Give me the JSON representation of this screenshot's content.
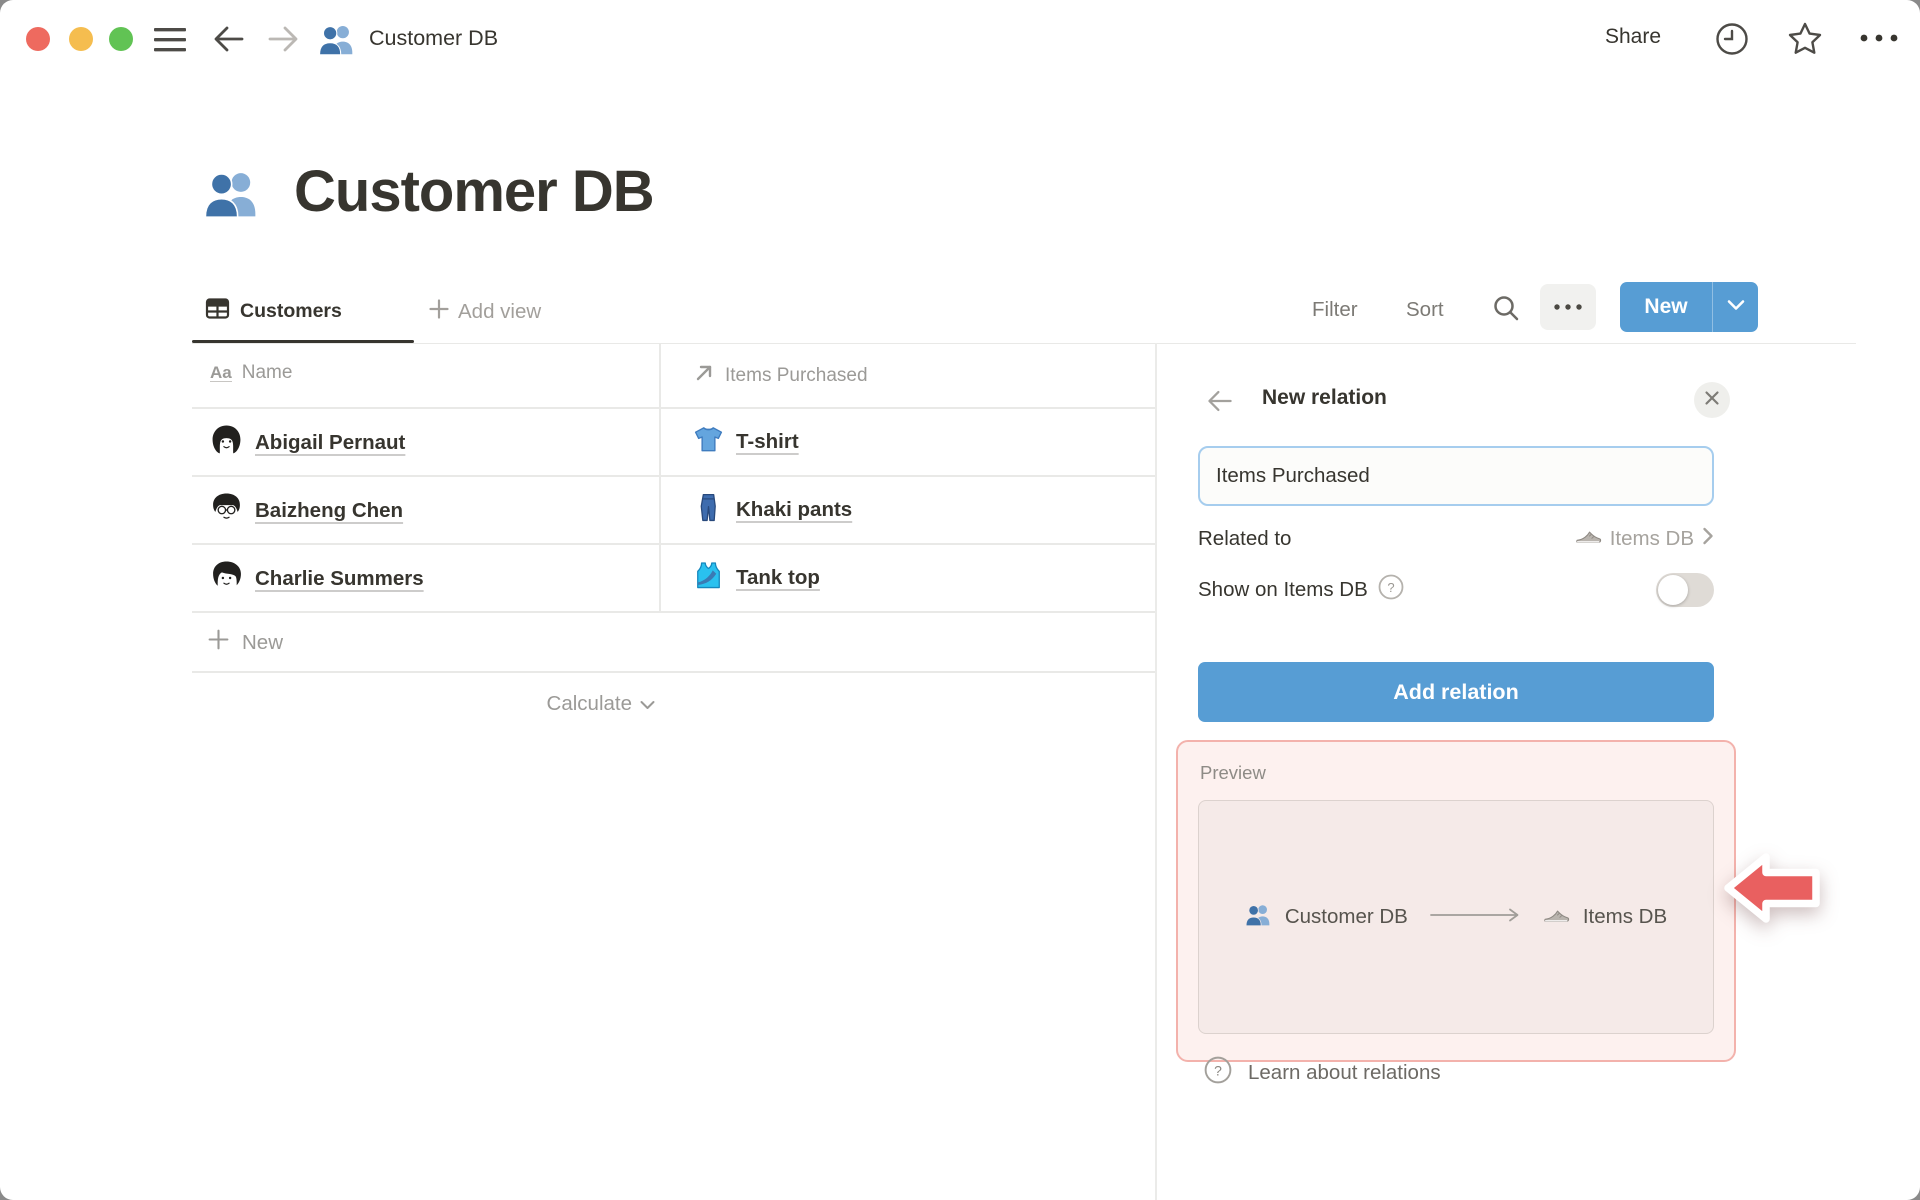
{
  "window": {
    "title": "Customer DB",
    "title_icon": "people-icon",
    "traffic_lights": [
      "close",
      "minimize",
      "zoom"
    ]
  },
  "titlebar": {
    "share_label": "Share",
    "icons": [
      "menu-icon",
      "back-arrow-icon",
      "forward-arrow-icon",
      "clock-icon",
      "star-icon",
      "more-icon"
    ]
  },
  "page": {
    "title": "Customer DB",
    "icon": "people-icon"
  },
  "toolbar": {
    "tab_label": "Customers",
    "tab_icon": "table-view-icon",
    "add_view_label": "Add view",
    "filter_label": "Filter",
    "sort_label": "Sort",
    "search_icon": "search-icon",
    "more_icon": "more-icon",
    "new_label": "New"
  },
  "table": {
    "columns": [
      {
        "label": "Name",
        "icon": "text-type-icon"
      },
      {
        "label": "Items Purchased",
        "icon": "relation-arrow-icon"
      }
    ],
    "rows": [
      {
        "name": "Abigail Pernaut",
        "avatar": "avatar-abigail",
        "item": "T-shirt",
        "item_icon": "tshirt-icon"
      },
      {
        "name": "Baizheng Chen",
        "avatar": "avatar-baizheng",
        "item": "Khaki pants",
        "item_icon": "pants-icon"
      },
      {
        "name": "Charlie Summers",
        "avatar": "avatar-charlie",
        "item": "Tank top",
        "item_icon": "tanktop-icon"
      }
    ],
    "new_row_label": "New",
    "calculate_label": "Calculate"
  },
  "panel": {
    "title": "New relation",
    "name_input": {
      "value": "Items Purchased"
    },
    "related_to": {
      "label": "Related to",
      "value": "Items DB",
      "value_icon": "shoe-icon"
    },
    "show_on": {
      "label": "Show on Items DB",
      "help_icon": "help-icon",
      "toggle_on": false
    },
    "add_button_label": "Add relation",
    "preview": {
      "label": "Preview",
      "from": "Customer DB",
      "from_icon": "people-icon",
      "to": "Items DB",
      "to_icon": "shoe-icon"
    },
    "learn_label": "Learn about relations"
  },
  "annotations": {
    "red_arrow": "points-left-at-preview-box"
  },
  "colors": {
    "accent_blue": "#579dd4",
    "focus_ring_blue": "#a6cdee",
    "pink_highlight_bg": "#fdf1ef",
    "pink_highlight_border": "#f3b2ac",
    "red_arrow": "#e96060",
    "text_dark": "#37352f",
    "text_gray": "#9b9a97",
    "divider": "#e9e9e7",
    "traffic_red": "#ee6a5f",
    "traffic_yellow": "#f5bd4f",
    "traffic_green": "#61c354"
  }
}
